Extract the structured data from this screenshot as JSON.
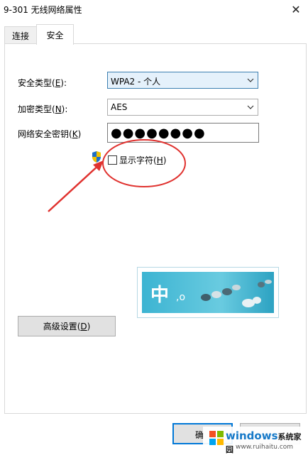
{
  "window": {
    "title": "9-301 无线网络属性",
    "close_glyph": "✕"
  },
  "tabs": [
    {
      "label": "连接",
      "active": false
    },
    {
      "label": "安全",
      "active": true
    }
  ],
  "security": {
    "security_type": {
      "label_text": "安全类型(",
      "label_key": "E",
      "label_end": "):",
      "value": "WPA2 - 个人"
    },
    "encryption_type": {
      "label_text": "加密类型(",
      "label_key": "N",
      "label_end": "):",
      "value": "AES"
    },
    "network_key": {
      "label_text": "网络安全密钥(",
      "label_key": "K",
      "label_end": ")",
      "masked_value": "●●●●●●●●"
    },
    "show_chars": {
      "label_text": "显示字符(",
      "label_key": "H",
      "label_end": ")",
      "checked": false
    }
  },
  "advanced": {
    "label_text": "高级设置(",
    "label_key": "D",
    "label_end": ")"
  },
  "footer": {
    "ok_label_partial": "确"
  },
  "banner": {
    "char": "中",
    "suffix": ",o"
  },
  "watermark": {
    "brand_main": "windows",
    "brand_cn": "系统家园",
    "url": "www.ruihaitu.com"
  },
  "colors": {
    "focus_blue": "#0078d7",
    "annotation_red": "#e0322f",
    "banner_blue": "#3cb4d2"
  }
}
